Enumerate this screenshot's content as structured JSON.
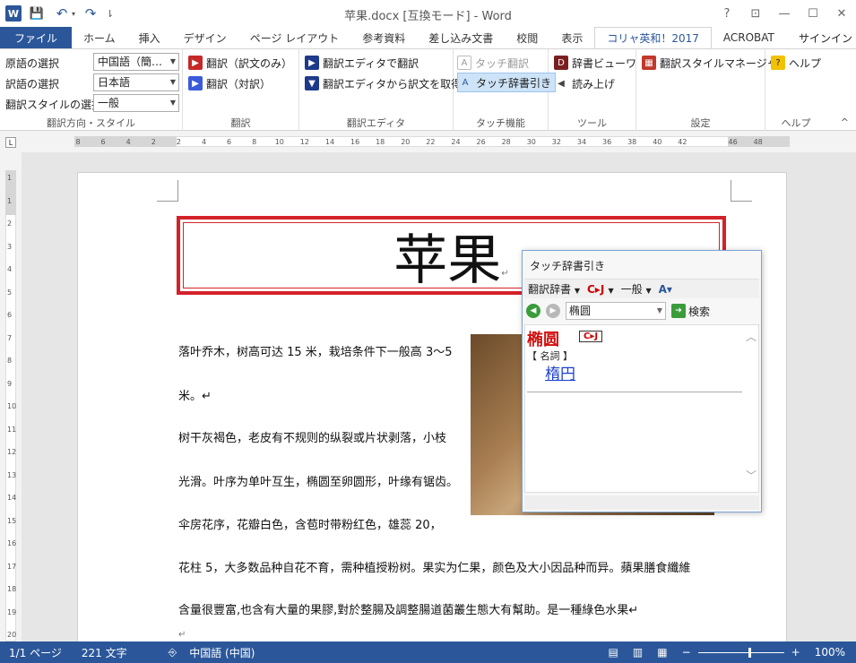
{
  "window": {
    "title": "苹果.docx [互換モード] - Word",
    "app_letter": "W",
    "help": "?",
    "controls": [
      "⊡",
      "—",
      "☐",
      "✕"
    ]
  },
  "qat": {
    "save": "💾",
    "undo": "↶",
    "redo": "↷",
    "more": "⇂"
  },
  "tabs": {
    "items": [
      "ファイル",
      "ホーム",
      "挿入",
      "デザイン",
      "ページ レイアウト",
      "参考資料",
      "差し込み文書",
      "校閲",
      "表示",
      "コリャ英和！2017",
      "ACROBAT"
    ],
    "active_index": 9,
    "signin": "サインイン"
  },
  "ribbon": {
    "g1": {
      "label": "翻訳方向・スタイル",
      "src_label": "原語の選択",
      "src_value": "中国語（簡…",
      "tgt_label": "訳語の選択",
      "tgt_value": "日本語",
      "style_label": "翻訳スタイルの選択",
      "style_value": "一般"
    },
    "g2": {
      "label": "翻訳",
      "b1": "翻訳（訳文のみ）",
      "b2": "翻訳（対訳）"
    },
    "g3": {
      "label": "翻訳エディタ",
      "b1": "翻訳エディタで翻訳",
      "b2": "翻訳エディタから訳文を取得"
    },
    "g4": {
      "label": "タッチ機能",
      "b1": "タッチ翻訳",
      "b2": "タッチ辞書引き"
    },
    "g5": {
      "label": "ツール",
      "b1": "辞書ビューワ",
      "b2": "読み上げ"
    },
    "g6": {
      "label": "設定",
      "b1": "翻訳スタイルマネージャ"
    },
    "g7": {
      "label": "ヘルプ",
      "b1": "ヘルプ",
      "collapse": "^"
    }
  },
  "ruler": {
    "h_labels": [
      "8",
      "6",
      "4",
      "2",
      "2",
      "4",
      "6",
      "8",
      "10",
      "12",
      "14",
      "16",
      "18",
      "20",
      "22",
      "24",
      "26",
      "28",
      "30",
      "32",
      "34",
      "36",
      "38",
      "40",
      "42",
      "46",
      "48"
    ],
    "v_labels": [
      "1",
      "1",
      "2",
      "3",
      "4",
      "5",
      "6",
      "7",
      "8",
      "9",
      "10",
      "11",
      "12",
      "13",
      "14",
      "15",
      "16",
      "17",
      "18",
      "19",
      "20"
    ],
    "tab_selector": "L"
  },
  "document": {
    "title": "苹果",
    "title_mark": "↵",
    "lines": [
      "落叶乔木，树高可达 15 米，栽培条件下一般高 3～5",
      "米。↵",
      "树干灰褐色，老皮有不规则的纵裂或片状剥落，小枝",
      "光滑。叶序为单叶互生，椭圆至卵圆形，叶缘有锯齿。",
      "伞房花序，花瓣白色，含苞时带粉红色，雄蕊 20，",
      "花柱 5，大多数品种自花不育，需种植授粉树。果实为仁果，颜色及大小因品种而异。蘋果膳食纖維",
      "含量很豐富,也含有大量的果膠,對於整腸及調整腸道菌叢生態大有幫助。是一種綠色水果↵",
      "↵"
    ]
  },
  "popup": {
    "title": "タッチ辞書引き",
    "dict_label": "翻訳辞書",
    "cj_label": "C▸J",
    "style_label": "一般",
    "search_value": "椭圆",
    "search_button": "検索",
    "headword": "椭圆",
    "cj_badge": "C▸J",
    "pos": "【 名詞 】",
    "translation": "楕円"
  },
  "status": {
    "page": "1/1 ページ",
    "chars": "221 文字",
    "lang": "中国語 (中国)",
    "zoom": "100%"
  }
}
